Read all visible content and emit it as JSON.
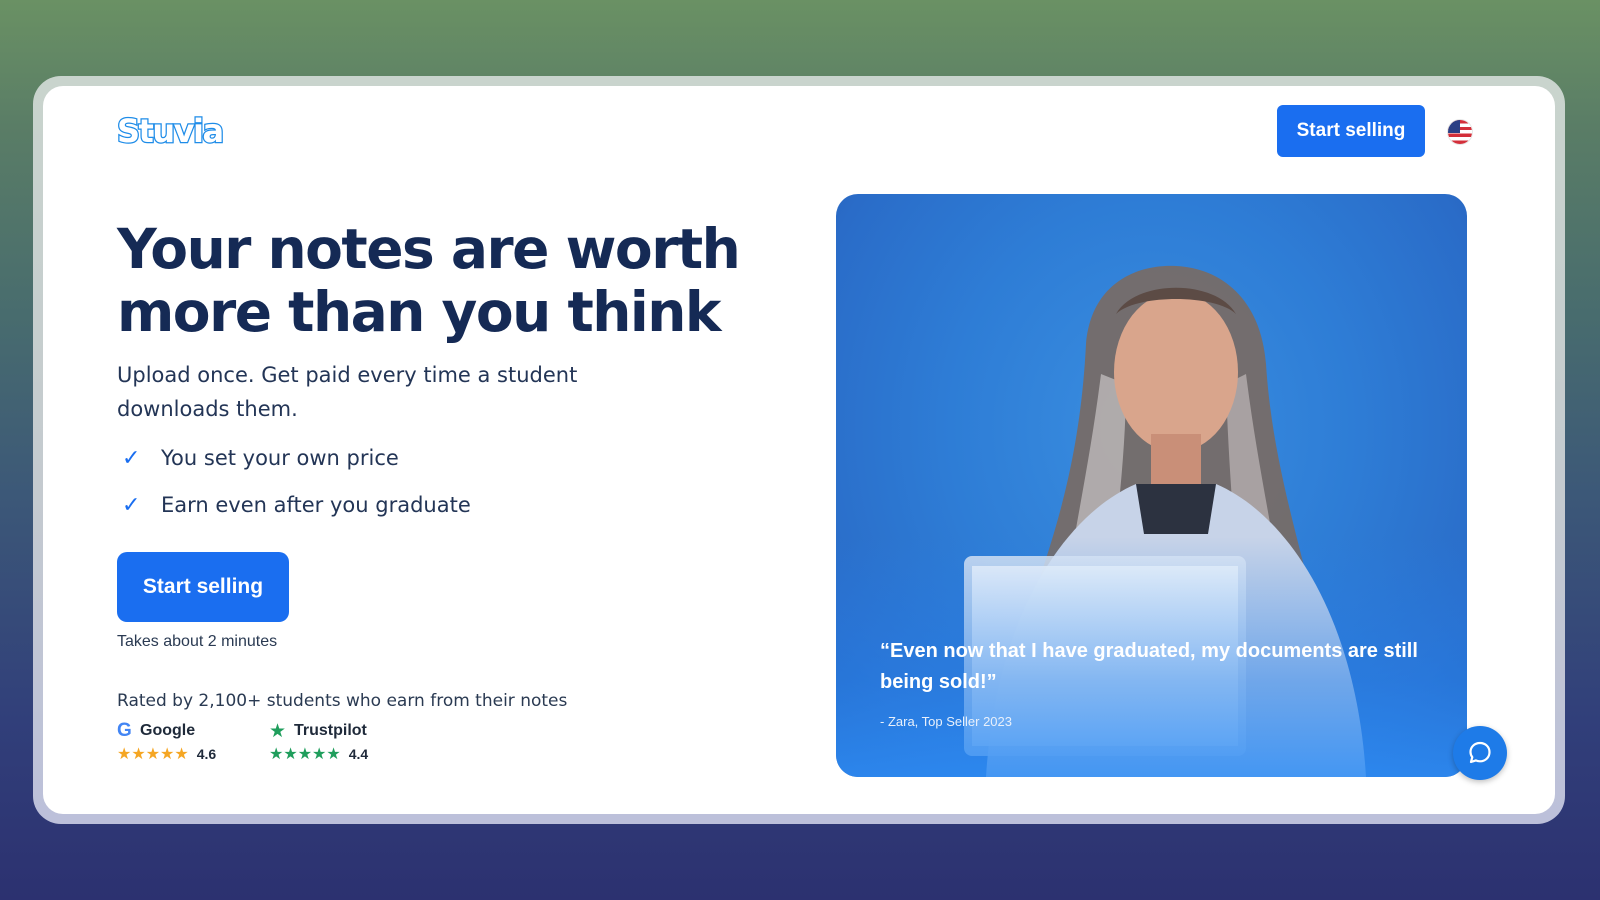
{
  "brand": {
    "logo_text": "Stuvia"
  },
  "header": {
    "cta_label": "Start selling",
    "language_icon": "us-flag-icon"
  },
  "hero": {
    "headline": "Your notes are worth more than you think",
    "subline": "Upload once. Get paid every time a student downloads them.",
    "benefits": [
      {
        "icon": "check-icon",
        "text": "You set your own price"
      },
      {
        "icon": "check-icon",
        "text": "Earn even after you graduate"
      }
    ],
    "cta_label": "Start selling",
    "cta_note": "Takes about 2 minutes",
    "rated_text": "Rated by 2,100+ students who earn from their notes"
  },
  "ratings": [
    {
      "name": "Google",
      "icon": "google-icon",
      "stars": "★★★★★",
      "score": "4.6",
      "star_color": "#f5a623"
    },
    {
      "name": "Trustpilot",
      "icon": "trustpilot-star-icon",
      "stars": "★★★★★",
      "score": "4.4",
      "star_color": "#1f9e5c"
    }
  ],
  "testimonial": {
    "quote": "“Even now that I have graduated, my documents are still being sold!”",
    "attribution": "- Zara, Top Seller 2023"
  },
  "chat": {
    "icon": "chat-bubble-icon"
  },
  "colors": {
    "accent": "#1a6ef0",
    "headline": "#152a55",
    "hero_blue": "#2e7dd6"
  }
}
